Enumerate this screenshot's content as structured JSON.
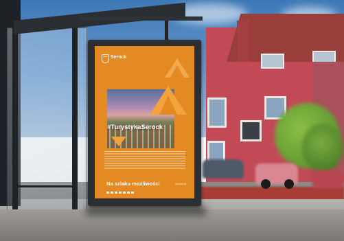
{
  "poster": {
    "brand_name": "Serock",
    "hashtag": "#TurystykaSerock",
    "tagline": "Na szlaku możliwości",
    "website": "serock.pl"
  },
  "colors": {
    "poster_orange": "#e38a23",
    "frame": "#2b2f34",
    "sky": "#4a83bf",
    "house_red": "#c24a57"
  },
  "icons": {
    "crest": "coat-of-arms-icon",
    "triangles": "triangle-shape"
  }
}
